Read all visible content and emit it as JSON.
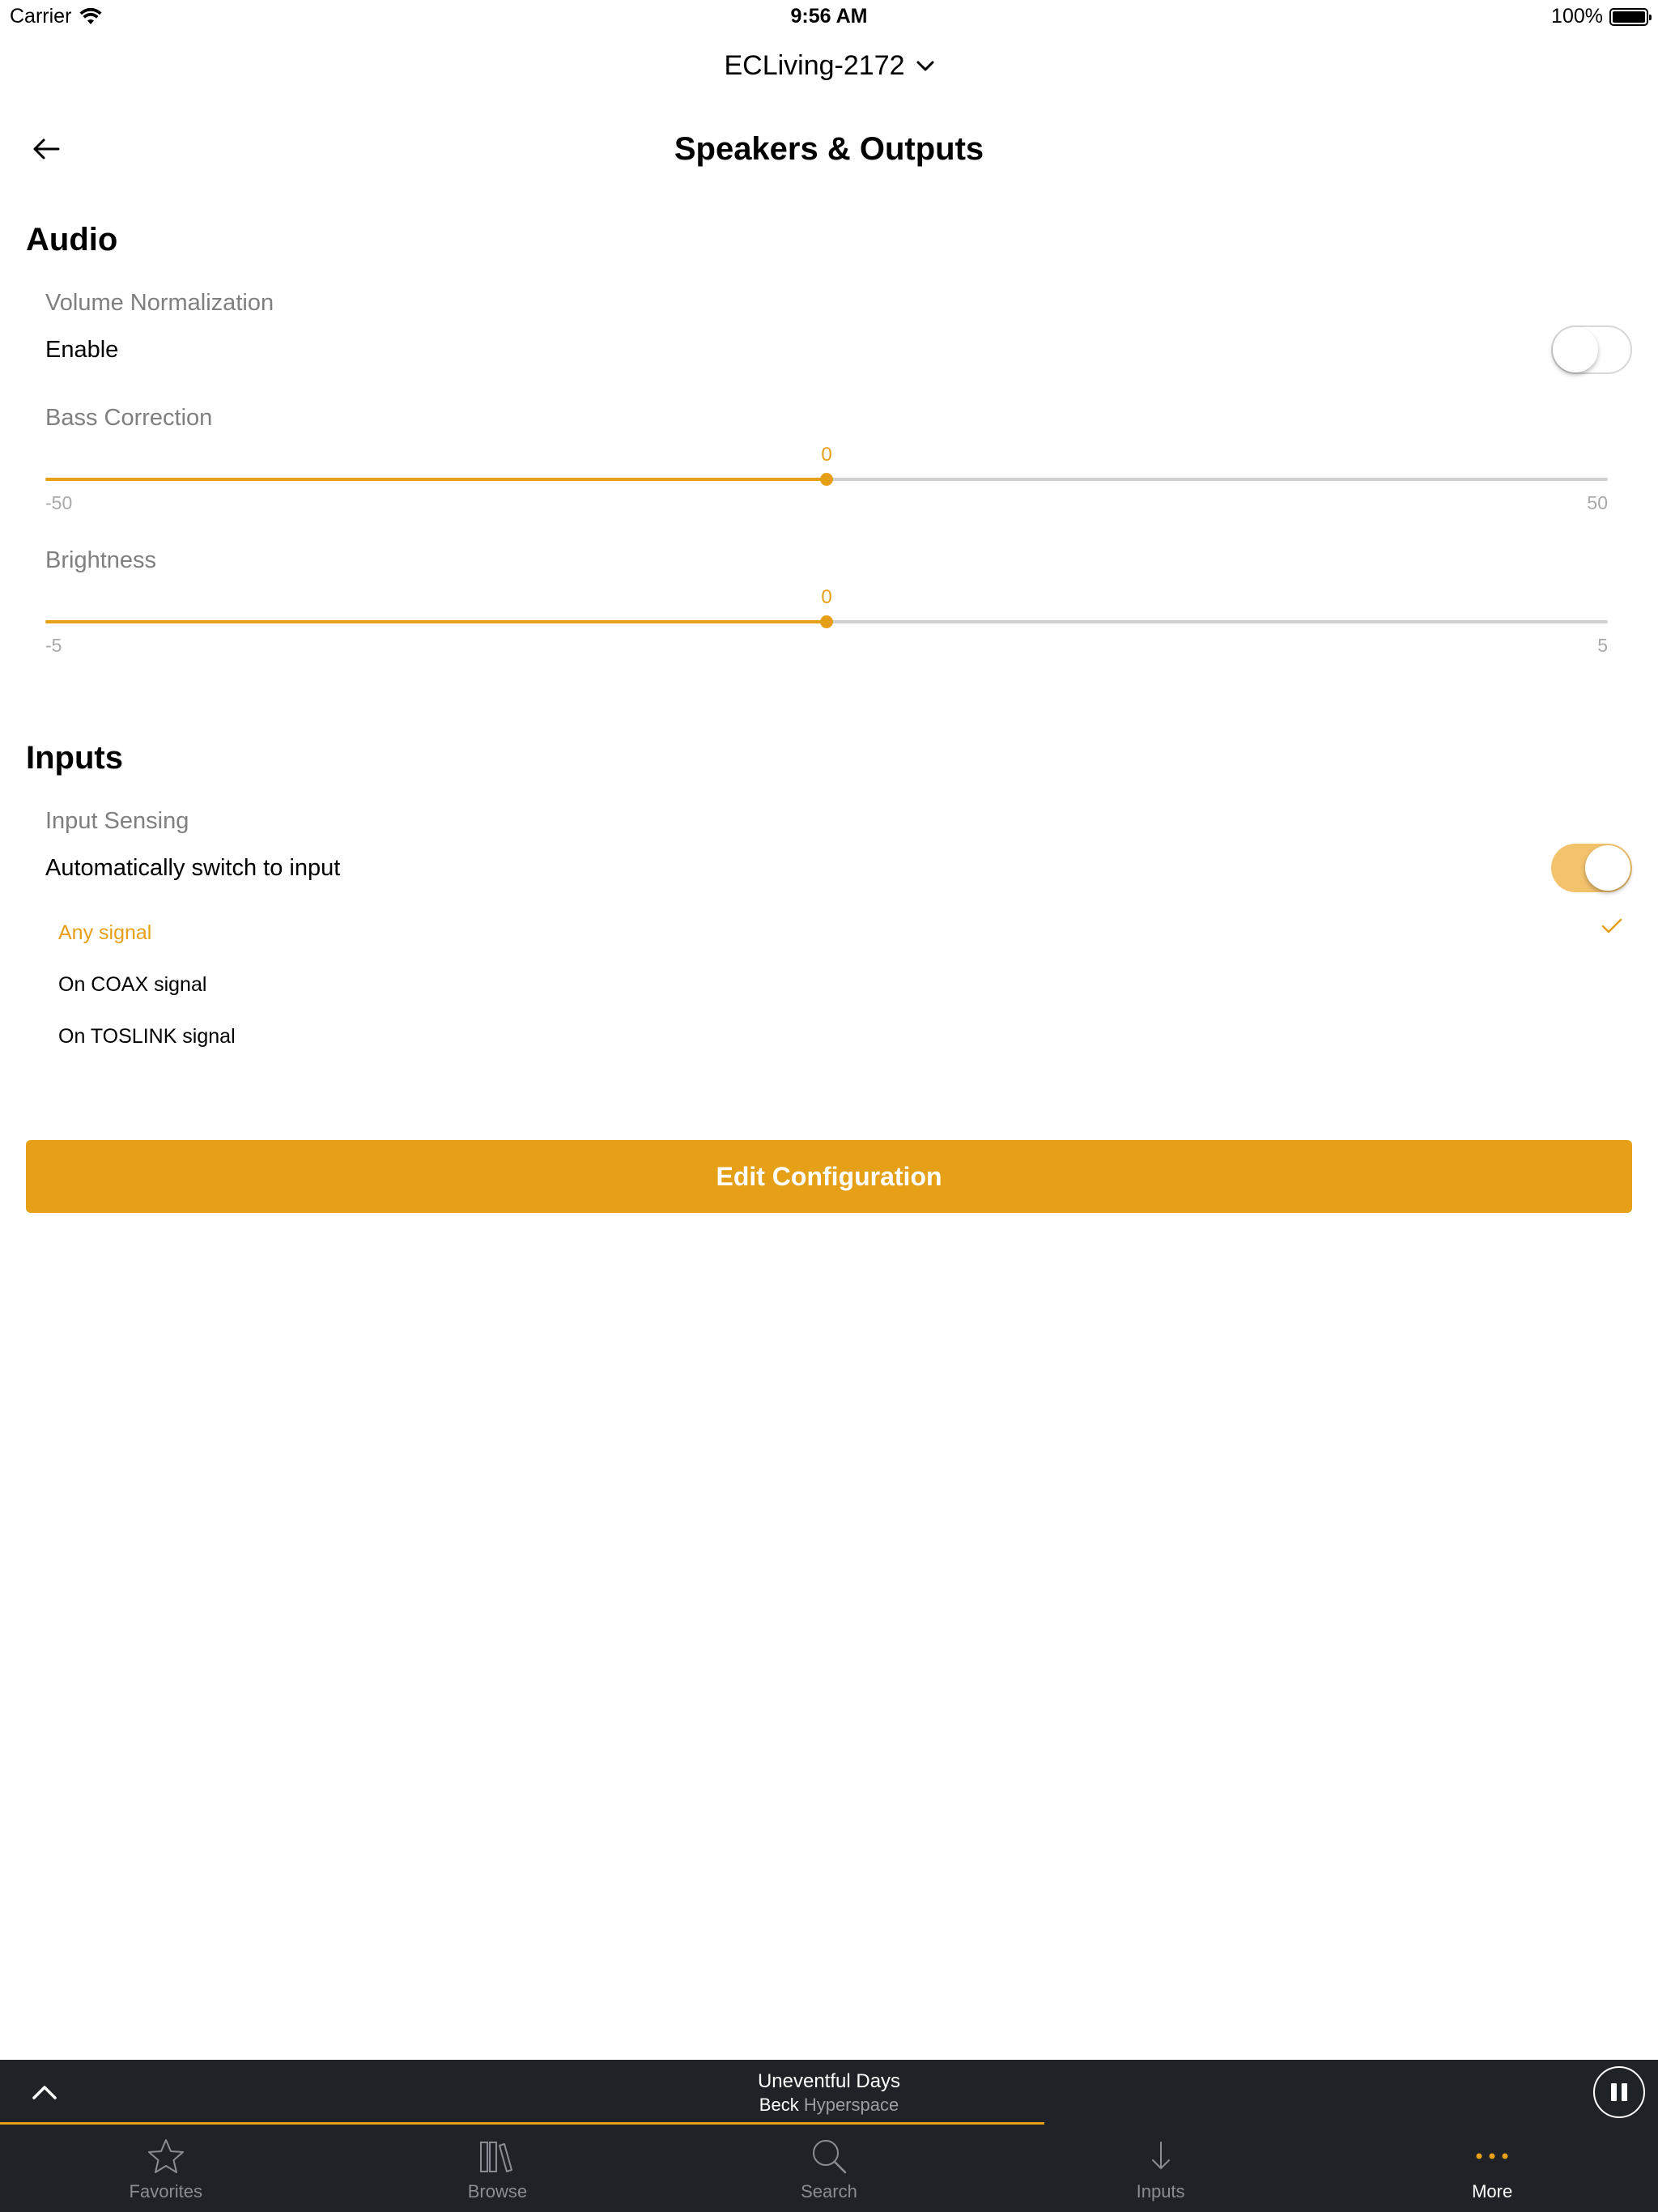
{
  "status_bar": {
    "carrier": "Carrier",
    "time": "9:56 AM",
    "battery": "100%",
    "battery_level": 1.0
  },
  "device": {
    "name": "ECLiving-2172"
  },
  "page": {
    "title": "Speakers & Outputs"
  },
  "audio": {
    "title": "Audio",
    "volume_normalization": {
      "label": "Volume Normalization",
      "enable_label": "Enable",
      "enabled": false
    },
    "bass_correction": {
      "label": "Bass Correction",
      "value": 0,
      "min": -50,
      "max": 50,
      "value_text": "0",
      "min_text": "-50",
      "max_text": "50"
    },
    "brightness": {
      "label": "Brightness",
      "value": 0,
      "min": -5,
      "max": 5,
      "value_text": "0",
      "min_text": "-5",
      "max_text": "5"
    }
  },
  "inputs": {
    "title": "Inputs",
    "input_sensing": {
      "label": "Input Sensing",
      "auto_switch_label": "Automatically switch to input",
      "enabled": true
    },
    "options": [
      {
        "label": "Any signal",
        "selected": true
      },
      {
        "label": "On COAX signal",
        "selected": false
      },
      {
        "label": "On TOSLINK signal",
        "selected": false
      }
    ]
  },
  "edit_button": {
    "label": "Edit Configuration"
  },
  "now_playing": {
    "title": "Uneventful Days",
    "artist": "Beck",
    "album": "Hyperspace",
    "progress": 0.63
  },
  "tabs": [
    {
      "label": "Favorites",
      "icon": "star-icon",
      "active": false
    },
    {
      "label": "Browse",
      "icon": "library-icon",
      "active": false
    },
    {
      "label": "Search",
      "icon": "search-icon",
      "active": false
    },
    {
      "label": "Inputs",
      "icon": "arrow-down-icon",
      "active": false
    },
    {
      "label": "More",
      "icon": "more-icon",
      "active": true
    }
  ],
  "colors": {
    "accent": "#e6a017",
    "toggle_on": "#f2c26d",
    "bar_background": "#1f2226"
  }
}
